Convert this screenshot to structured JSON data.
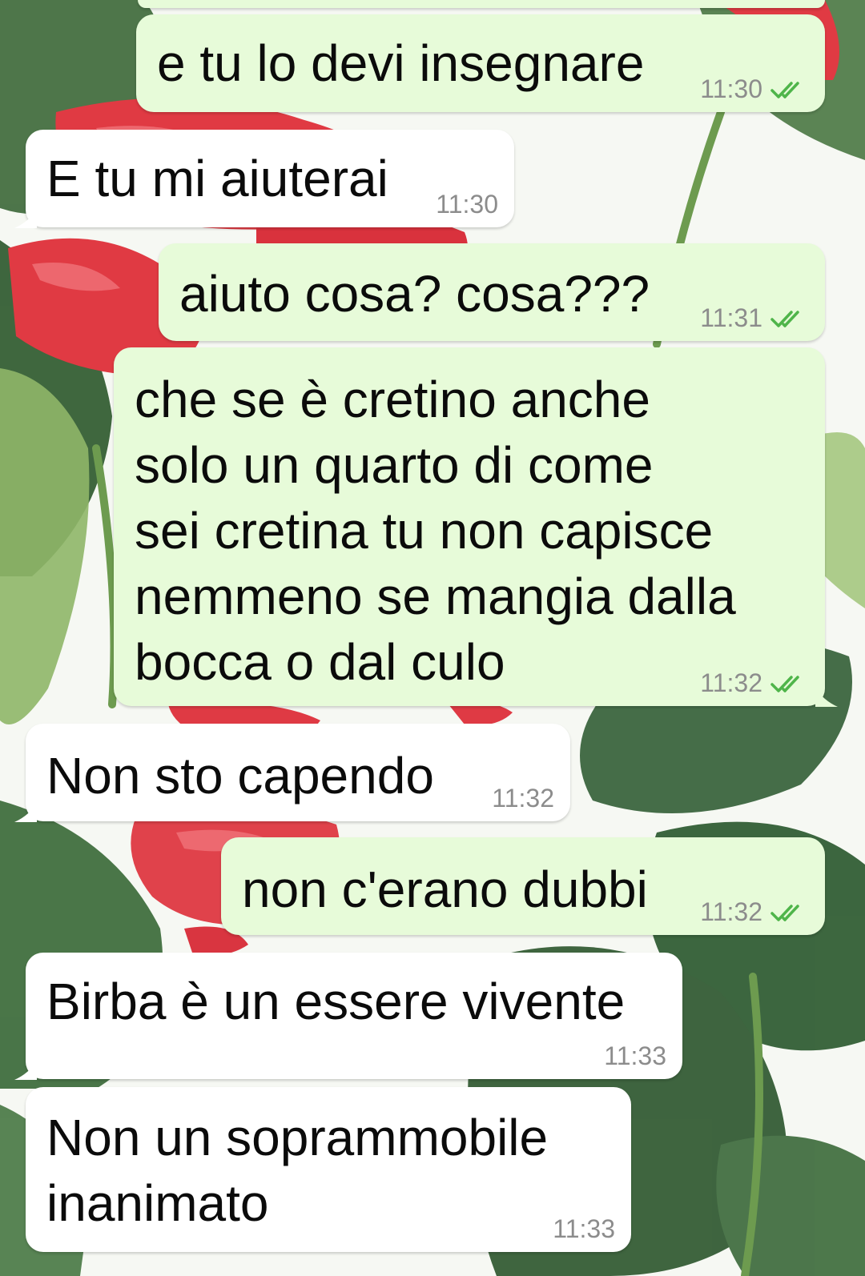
{
  "colors": {
    "outgoing_bubble": "#e7fbd9",
    "incoming_bubble": "#ffffff",
    "timestamp": "#8c8c8c",
    "read_ticks": "#4fb54a"
  },
  "messages": [
    {
      "direction": "out",
      "text": "e tu lo devi insegnare",
      "time": "11:30",
      "status": "read-ticks-icon"
    },
    {
      "direction": "in",
      "text": "E tu mi aiuterai",
      "time": "11:30"
    },
    {
      "direction": "out",
      "text": "aiuto cosa? cosa???",
      "time": "11:31",
      "status": "read-ticks-icon"
    },
    {
      "direction": "out",
      "lines": [
        "che se è cretino anche",
        "solo un quarto di come",
        "sei cretina tu non capisce",
        "nemmeno se mangia dalla",
        "bocca o dal culo"
      ],
      "time": "11:32",
      "status": "read-ticks-icon"
    },
    {
      "direction": "in",
      "text": "Non sto capendo",
      "time": "11:32"
    },
    {
      "direction": "out",
      "text": "non c'erano dubbi",
      "time": "11:32",
      "status": "read-ticks-icon"
    },
    {
      "direction": "in",
      "text": "Birba è un essere vivente",
      "time": "11:33"
    },
    {
      "direction": "in",
      "lines": [
        "Non un soprammobile",
        "inanimato"
      ],
      "time": "11:33"
    }
  ]
}
